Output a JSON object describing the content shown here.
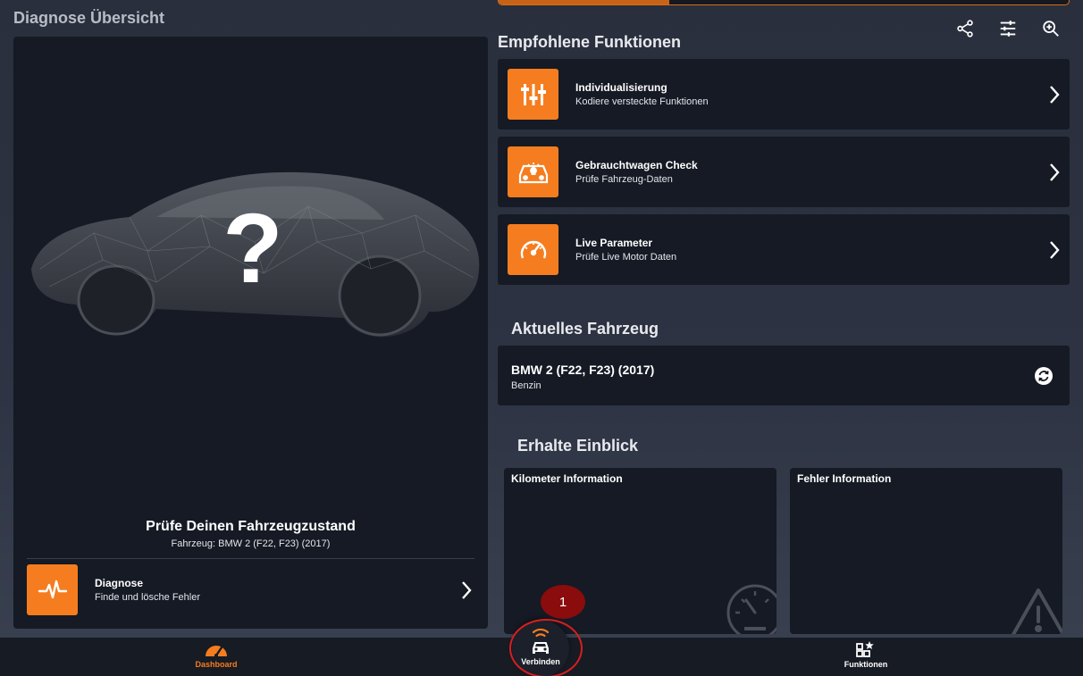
{
  "left": {
    "title": "Diagnose Übersicht",
    "check_title": "Prüfe Deinen Fahrzeugzustand",
    "check_subtitle": "Fahrzeug: BMW 2 (F22, F23) (2017)",
    "diagnose": {
      "title": "Diagnose",
      "subtitle": "Finde und lösche Fehler",
      "icon": "pulse-icon"
    }
  },
  "toolbar": {
    "icons": [
      "share-icon",
      "tune-icon",
      "zoom-in-icon"
    ]
  },
  "progress": {
    "value": 0.3
  },
  "recommended": {
    "title": "Empfohlene Funktionen",
    "items": [
      {
        "title": "Individualisierung",
        "subtitle": "Kodiere versteckte Funktionen",
        "icon": "sliders-icon"
      },
      {
        "title": "Gebrauchtwagen Check",
        "subtitle": "Prüfe Fahrzeug-Daten",
        "icon": "car-lightbulb-icon"
      },
      {
        "title": "Live Parameter",
        "subtitle": "Prüfe Live Motor Daten",
        "icon": "gauge-icon"
      }
    ]
  },
  "vehicle": {
    "title": "Aktuelles Fahrzeug",
    "name": "BMW 2 (F22, F23) (2017)",
    "fuel": "Benzin"
  },
  "insights": {
    "title": "Erhalte Einblick",
    "km": "Kilometer Information",
    "errors": "Fehler Information"
  },
  "nav": {
    "dashboard": "Dashboard",
    "connect": "Verbinden",
    "functions": "Funktionen"
  },
  "annotation": {
    "label": "1"
  },
  "colors": {
    "accent": "#f57d1f",
    "card": "#151a24",
    "annotation": "#d81e1e"
  }
}
